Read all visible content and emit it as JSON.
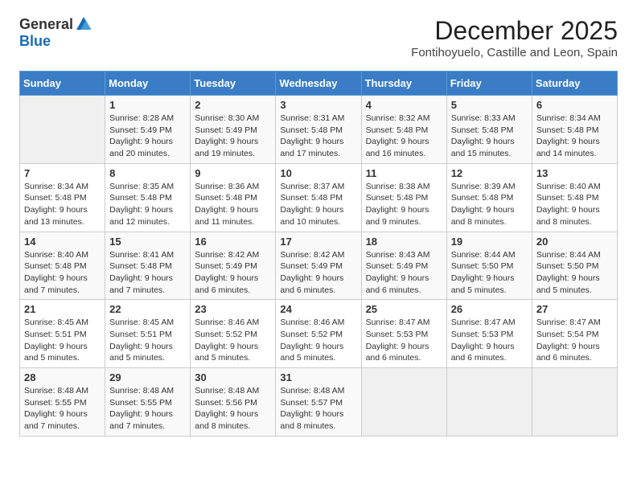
{
  "logo": {
    "general": "General",
    "blue": "Blue"
  },
  "title": "December 2025",
  "location": "Fontihoyuelo, Castille and Leon, Spain",
  "days_of_week": [
    "Sunday",
    "Monday",
    "Tuesday",
    "Wednesday",
    "Thursday",
    "Friday",
    "Saturday"
  ],
  "weeks": [
    [
      {
        "day": "",
        "sunrise": "",
        "sunset": "",
        "daylight": ""
      },
      {
        "day": "1",
        "sunrise": "Sunrise: 8:28 AM",
        "sunset": "Sunset: 5:49 PM",
        "daylight": "Daylight: 9 hours and 20 minutes."
      },
      {
        "day": "2",
        "sunrise": "Sunrise: 8:30 AM",
        "sunset": "Sunset: 5:49 PM",
        "daylight": "Daylight: 9 hours and 19 minutes."
      },
      {
        "day": "3",
        "sunrise": "Sunrise: 8:31 AM",
        "sunset": "Sunset: 5:48 PM",
        "daylight": "Daylight: 9 hours and 17 minutes."
      },
      {
        "day": "4",
        "sunrise": "Sunrise: 8:32 AM",
        "sunset": "Sunset: 5:48 PM",
        "daylight": "Daylight: 9 hours and 16 minutes."
      },
      {
        "day": "5",
        "sunrise": "Sunrise: 8:33 AM",
        "sunset": "Sunset: 5:48 PM",
        "daylight": "Daylight: 9 hours and 15 minutes."
      },
      {
        "day": "6",
        "sunrise": "Sunrise: 8:34 AM",
        "sunset": "Sunset: 5:48 PM",
        "daylight": "Daylight: 9 hours and 14 minutes."
      }
    ],
    [
      {
        "day": "7",
        "sunrise": "Sunrise: 8:34 AM",
        "sunset": "Sunset: 5:48 PM",
        "daylight": "Daylight: 9 hours and 13 minutes."
      },
      {
        "day": "8",
        "sunrise": "Sunrise: 8:35 AM",
        "sunset": "Sunset: 5:48 PM",
        "daylight": "Daylight: 9 hours and 12 minutes."
      },
      {
        "day": "9",
        "sunrise": "Sunrise: 8:36 AM",
        "sunset": "Sunset: 5:48 PM",
        "daylight": "Daylight: 9 hours and 11 minutes."
      },
      {
        "day": "10",
        "sunrise": "Sunrise: 8:37 AM",
        "sunset": "Sunset: 5:48 PM",
        "daylight": "Daylight: 9 hours and 10 minutes."
      },
      {
        "day": "11",
        "sunrise": "Sunrise: 8:38 AM",
        "sunset": "Sunset: 5:48 PM",
        "daylight": "Daylight: 9 hours and 9 minutes."
      },
      {
        "day": "12",
        "sunrise": "Sunrise: 8:39 AM",
        "sunset": "Sunset: 5:48 PM",
        "daylight": "Daylight: 9 hours and 8 minutes."
      },
      {
        "day": "13",
        "sunrise": "Sunrise: 8:40 AM",
        "sunset": "Sunset: 5:48 PM",
        "daylight": "Daylight: 9 hours and 8 minutes."
      }
    ],
    [
      {
        "day": "14",
        "sunrise": "Sunrise: 8:40 AM",
        "sunset": "Sunset: 5:48 PM",
        "daylight": "Daylight: 9 hours and 7 minutes."
      },
      {
        "day": "15",
        "sunrise": "Sunrise: 8:41 AM",
        "sunset": "Sunset: 5:48 PM",
        "daylight": "Daylight: 9 hours and 7 minutes."
      },
      {
        "day": "16",
        "sunrise": "Sunrise: 8:42 AM",
        "sunset": "Sunset: 5:49 PM",
        "daylight": "Daylight: 9 hours and 6 minutes."
      },
      {
        "day": "17",
        "sunrise": "Sunrise: 8:42 AM",
        "sunset": "Sunset: 5:49 PM",
        "daylight": "Daylight: 9 hours and 6 minutes."
      },
      {
        "day": "18",
        "sunrise": "Sunrise: 8:43 AM",
        "sunset": "Sunset: 5:49 PM",
        "daylight": "Daylight: 9 hours and 6 minutes."
      },
      {
        "day": "19",
        "sunrise": "Sunrise: 8:44 AM",
        "sunset": "Sunset: 5:50 PM",
        "daylight": "Daylight: 9 hours and 5 minutes."
      },
      {
        "day": "20",
        "sunrise": "Sunrise: 8:44 AM",
        "sunset": "Sunset: 5:50 PM",
        "daylight": "Daylight: 9 hours and 5 minutes."
      }
    ],
    [
      {
        "day": "21",
        "sunrise": "Sunrise: 8:45 AM",
        "sunset": "Sunset: 5:51 PM",
        "daylight": "Daylight: 9 hours and 5 minutes."
      },
      {
        "day": "22",
        "sunrise": "Sunrise: 8:45 AM",
        "sunset": "Sunset: 5:51 PM",
        "daylight": "Daylight: 9 hours and 5 minutes."
      },
      {
        "day": "23",
        "sunrise": "Sunrise: 8:46 AM",
        "sunset": "Sunset: 5:52 PM",
        "daylight": "Daylight: 9 hours and 5 minutes."
      },
      {
        "day": "24",
        "sunrise": "Sunrise: 8:46 AM",
        "sunset": "Sunset: 5:52 PM",
        "daylight": "Daylight: 9 hours and 5 minutes."
      },
      {
        "day": "25",
        "sunrise": "Sunrise: 8:47 AM",
        "sunset": "Sunset: 5:53 PM",
        "daylight": "Daylight: 9 hours and 6 minutes."
      },
      {
        "day": "26",
        "sunrise": "Sunrise: 8:47 AM",
        "sunset": "Sunset: 5:53 PM",
        "daylight": "Daylight: 9 hours and 6 minutes."
      },
      {
        "day": "27",
        "sunrise": "Sunrise: 8:47 AM",
        "sunset": "Sunset: 5:54 PM",
        "daylight": "Daylight: 9 hours and 6 minutes."
      }
    ],
    [
      {
        "day": "28",
        "sunrise": "Sunrise: 8:48 AM",
        "sunset": "Sunset: 5:55 PM",
        "daylight": "Daylight: 9 hours and 7 minutes."
      },
      {
        "day": "29",
        "sunrise": "Sunrise: 8:48 AM",
        "sunset": "Sunset: 5:55 PM",
        "daylight": "Daylight: 9 hours and 7 minutes."
      },
      {
        "day": "30",
        "sunrise": "Sunrise: 8:48 AM",
        "sunset": "Sunset: 5:56 PM",
        "daylight": "Daylight: 9 hours and 8 minutes."
      },
      {
        "day": "31",
        "sunrise": "Sunrise: 8:48 AM",
        "sunset": "Sunset: 5:57 PM",
        "daylight": "Daylight: 9 hours and 8 minutes."
      },
      {
        "day": "",
        "sunrise": "",
        "sunset": "",
        "daylight": ""
      },
      {
        "day": "",
        "sunrise": "",
        "sunset": "",
        "daylight": ""
      },
      {
        "day": "",
        "sunrise": "",
        "sunset": "",
        "daylight": ""
      }
    ]
  ]
}
